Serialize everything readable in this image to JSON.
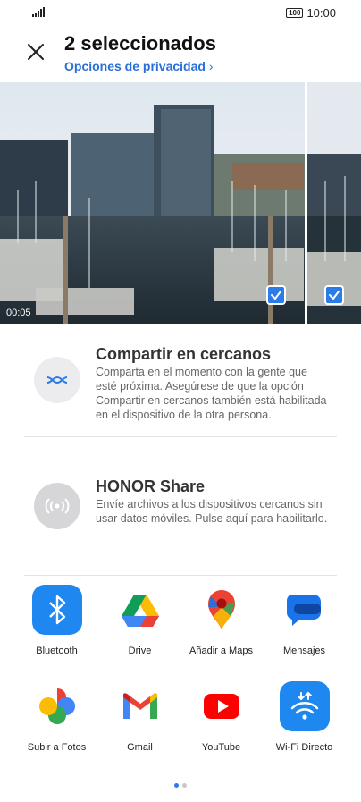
{
  "status_bar": {
    "time": "10:00",
    "battery": "100"
  },
  "header": {
    "title": "2 seleccionados",
    "privacy_link": "Opciones de privacidad"
  },
  "media": {
    "duration": "00:05"
  },
  "nearby": {
    "title": "Compartir en cercanos",
    "description": "Comparta en el momento con la gente que esté próxima. Asegúrese de que la opción Compartir en cercanos también está habilitada en el dispositivo de la otra persona."
  },
  "honor_share": {
    "title": "HONOR Share",
    "description": "Envíe archivos a los dispositivos cercanos sin usar datos móviles. Pulse aquí para habilitarlo."
  },
  "apps": [
    {
      "label": "Bluetooth",
      "icon": "bluetooth-icon"
    },
    {
      "label": "Drive",
      "icon": "google-drive-icon"
    },
    {
      "label": "Añadir a Maps",
      "icon": "google-maps-icon"
    },
    {
      "label": "Mensajes",
      "icon": "messages-icon"
    },
    {
      "label": "Subir a Fotos",
      "icon": "google-photos-icon"
    },
    {
      "label": "Gmail",
      "icon": "gmail-icon"
    },
    {
      "label": "YouTube",
      "icon": "youtube-icon"
    },
    {
      "label": "Wi-Fi Directo",
      "icon": "wifi-direct-icon"
    }
  ],
  "colors": {
    "accent": "#2b7be8",
    "link": "#2a6fd8"
  }
}
